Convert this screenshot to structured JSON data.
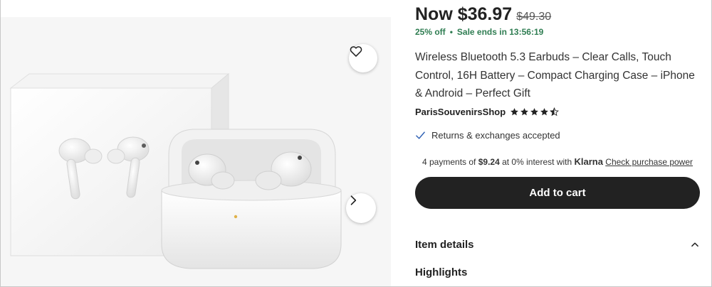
{
  "gallery": {
    "image_alt": "",
    "favorite_icon": "heart-icon",
    "next_icon": "chevron-right-icon"
  },
  "price": {
    "now": "Now $36.97",
    "original": "$49.30"
  },
  "sale": {
    "discount": "25% off",
    "separator": "•",
    "ends": "Sale ends in 13:56:19"
  },
  "product": {
    "title": "Wireless Bluetooth 5.3 Earbuds – Clear Calls, Touch Control, 16H Battery – Compact Charging Case – iPhone & Android – Perfect Gift"
  },
  "shop": {
    "name": "ParisSouvenirsShop",
    "rating": 4.5,
    "max_rating": 5
  },
  "returns": {
    "label": "Returns & exchanges accepted",
    "icon": "check-icon"
  },
  "klarna": {
    "prefix": "4 payments of ",
    "amount": "$9.24",
    "middle": " at 0% interest with ",
    "brand": "Klarna",
    "link": "Check purchase power"
  },
  "cart": {
    "label": "Add to cart"
  },
  "details": {
    "label": "Item details",
    "icon": "chevron-up-icon"
  },
  "highlights": {
    "label": "Highlights"
  },
  "colors": {
    "sale_green": "#2f7d52",
    "button_dark": "#222222",
    "star": "#222222"
  }
}
